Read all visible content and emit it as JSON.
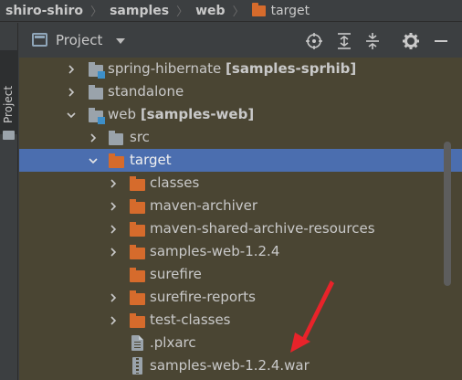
{
  "breadcrumb": {
    "items": [
      "shiro-shiro",
      "samples",
      "web",
      "target"
    ]
  },
  "side_stripe": {
    "tab_label": "Project"
  },
  "panel": {
    "title": "Project",
    "tools": [
      "locate-icon",
      "expand-all-icon",
      "collapse-all-icon",
      "gear-icon",
      "minimize-icon"
    ]
  },
  "tree": {
    "rows": [
      {
        "label": "spring-hibernate",
        "module": "[samples-sprhib]",
        "icon": "module-folder-icon",
        "expanded": false
      },
      {
        "label": "standalone",
        "icon": "folder-icon",
        "expanded": false
      },
      {
        "label": "web",
        "module": "[samples-web]",
        "icon": "module-folder-icon",
        "expanded": true
      },
      {
        "label": "src",
        "icon": "folder-icon",
        "expanded": false
      },
      {
        "label": "target",
        "icon": "excluded-folder-icon",
        "expanded": true,
        "selected": true
      },
      {
        "label": "classes",
        "icon": "excluded-folder-icon",
        "expanded": false
      },
      {
        "label": "maven-archiver",
        "icon": "excluded-folder-icon",
        "expanded": false
      },
      {
        "label": "maven-shared-archive-resources",
        "icon": "excluded-folder-icon",
        "expanded": false
      },
      {
        "label": "samples-web-1.2.4",
        "icon": "excluded-folder-icon",
        "expanded": false
      },
      {
        "label": "surefire",
        "icon": "excluded-folder-icon"
      },
      {
        "label": "surefire-reports",
        "icon": "excluded-folder-icon",
        "expanded": false
      },
      {
        "label": "test-classes",
        "icon": "excluded-folder-icon",
        "expanded": false
      },
      {
        "label": ".plxarc",
        "icon": "text-file-icon"
      },
      {
        "label": "samples-web-1.2.4.war",
        "icon": "archive-file-icon"
      }
    ]
  },
  "colors": {
    "selection": "#4b6eaf",
    "tree_background": "#4a4533",
    "excluded_folder": "#d66b2c",
    "annotation_arrow": "#e8232a"
  }
}
